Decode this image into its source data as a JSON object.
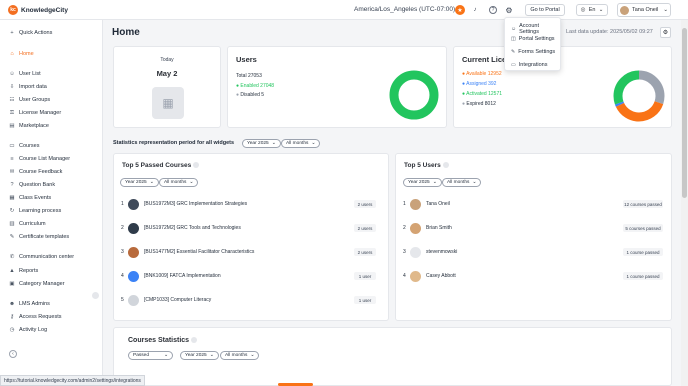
{
  "app": {
    "logo_letter": "kc",
    "name": "KnowledgeCity"
  },
  "header": {
    "timezone": "America/Los_Angeles (UTC-07:00)",
    "portal_button": "Go to Portal",
    "language": "En",
    "user_name": "Tana Oneil"
  },
  "settings_menu": {
    "items": [
      "Account Settings",
      "Portal Settings",
      "Forms Settings",
      "Integrations"
    ]
  },
  "sidebar": {
    "items": [
      {
        "label": "Quick Actions",
        "icon": "+"
      },
      {
        "label": "Home",
        "icon": "⌂"
      },
      {
        "label": "User List",
        "icon": "☺"
      },
      {
        "label": "Import data",
        "icon": "⇩"
      },
      {
        "label": "User Groups",
        "icon": "☷"
      },
      {
        "label": "License Manager",
        "icon": "⚿"
      },
      {
        "label": "Marketplace",
        "icon": "▤"
      },
      {
        "label": "Courses",
        "icon": "▭"
      },
      {
        "label": "Course List Manager",
        "icon": "≡"
      },
      {
        "label": "Course Feedback",
        "icon": "✉"
      },
      {
        "label": "Question Bank",
        "icon": "?"
      },
      {
        "label": "Class Events",
        "icon": "▦"
      },
      {
        "label": "Learning process",
        "icon": "↻"
      },
      {
        "label": "Curriculum",
        "icon": "▥"
      },
      {
        "label": "Certificate templates",
        "icon": "✎"
      },
      {
        "label": "Communication center",
        "icon": "✆"
      },
      {
        "label": "Reports",
        "icon": "▲"
      },
      {
        "label": "Category Manager",
        "icon": "▣"
      },
      {
        "label": "LMS Admins",
        "icon": "☻"
      },
      {
        "label": "Access Requests",
        "icon": "⚷"
      },
      {
        "label": "Activity Log",
        "icon": "◷"
      }
    ],
    "collapse_icon": "‹"
  },
  "main": {
    "title": "Home",
    "last_update": "Last data update: 2025/05/02 09:27",
    "today": {
      "label": "Today",
      "date": "May 2"
    },
    "users": {
      "title": "Users",
      "total": "Total 27053",
      "enabled": "Enabled 27048",
      "disabled": "Disabled 5"
    },
    "licenses": {
      "title": "Current Licenses",
      "available": "Available 12952",
      "assigned": "Assigned 392",
      "activated": "Activated 12571",
      "expired": "Expired 8012"
    },
    "period_label": "Statistics representation period for all widgets",
    "year_filter": "Year 2025",
    "months_filter": "All months",
    "top_courses": {
      "title": "Top 5 Passed Courses",
      "items": [
        {
          "n": "1",
          "name": "[BUS1972M3] GRC Implementation Strategies",
          "count": "2 users"
        },
        {
          "n": "2",
          "name": "[BUS1972M2] GRC Tools and Technologies",
          "count": "2 users"
        },
        {
          "n": "3",
          "name": "[BUS1477M2] Essential Facilitator Characteristics",
          "count": "2 users"
        },
        {
          "n": "4",
          "name": "[BNK1009] FATCA Implementation",
          "count": "1 user"
        },
        {
          "n": "5",
          "name": "[CMP1033] Computer Literacy",
          "count": "1 user"
        }
      ]
    },
    "top_users": {
      "title": "Top 5 Users",
      "items": [
        {
          "n": "1",
          "name": "Tana Oneil",
          "count": "12 courses passed"
        },
        {
          "n": "2",
          "name": "Brian Smith",
          "count": "5 courses passed"
        },
        {
          "n": "3",
          "name": "stevenmowski",
          "count": "1 course passed"
        },
        {
          "n": "4",
          "name": "Casey Abbott",
          "count": "1 course passed"
        }
      ]
    },
    "course_stats": {
      "title": "Courses Statistics",
      "status_filter": "Passed"
    }
  },
  "status_bar_url": "https://tutorial.knowledgecity.com/admin2/settings/integrations",
  "colors": {
    "accent": "#f36f21",
    "enabled": "#22c55e",
    "available": "#f97316",
    "assigned": "#3b82f6",
    "activated": "#22c55e",
    "expired": "#9ca3af"
  }
}
